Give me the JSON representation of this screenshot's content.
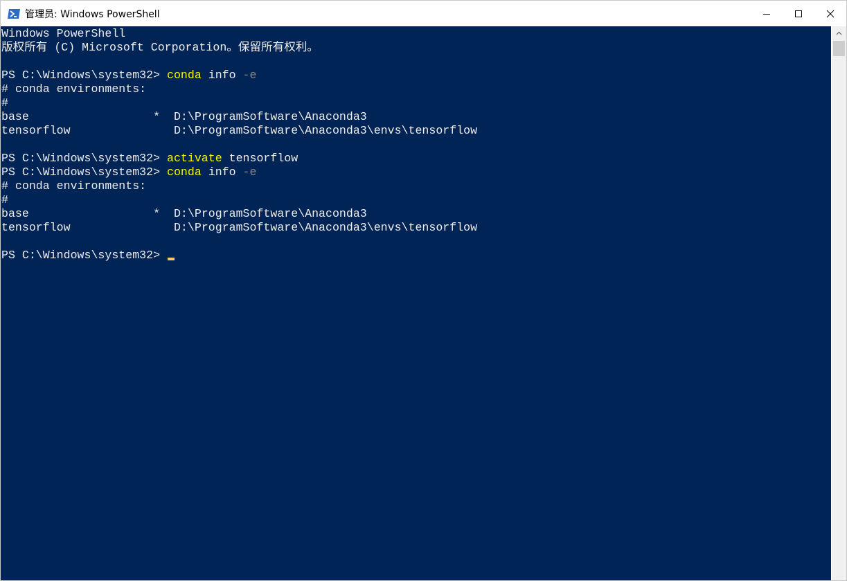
{
  "window": {
    "title": "管理员: Windows PowerShell",
    "app_icon": "powershell-icon",
    "controls": [
      "minimize-icon",
      "maximize-icon",
      "close-icon"
    ]
  },
  "console": {
    "lines": [
      {
        "text": "Windows PowerShell"
      },
      {
        "text": "版权所有 (C) Microsoft Corporation。保留所有权利。"
      },
      {
        "text": ""
      },
      {
        "prompt": "PS C:\\Windows\\system32> ",
        "command": "conda",
        "args": " info ",
        "param": "-e"
      },
      {
        "text": "# conda environments:"
      },
      {
        "text": "#"
      },
      {
        "text": "base                  *  D:\\ProgramSoftware\\Anaconda3"
      },
      {
        "text": "tensorflow               D:\\ProgramSoftware\\Anaconda3\\envs\\tensorflow"
      },
      {
        "text": ""
      },
      {
        "prompt": "PS C:\\Windows\\system32> ",
        "command": "activate",
        "args": " tensorflow",
        "param": ""
      },
      {
        "prompt": "PS C:\\Windows\\system32> ",
        "command": "conda",
        "args": " info ",
        "param": "-e"
      },
      {
        "text": "# conda environments:"
      },
      {
        "text": "#"
      },
      {
        "text": "base                  *  D:\\ProgramSoftware\\Anaconda3"
      },
      {
        "text": "tensorflow               D:\\ProgramSoftware\\Anaconda3\\envs\\tensorflow"
      },
      {
        "text": ""
      },
      {
        "prompt": "PS C:\\Windows\\system32> ",
        "command": "",
        "args": "",
        "param": "",
        "cursor": true
      }
    ]
  },
  "colors": {
    "console_bg": "#012456",
    "text": "#ececec",
    "command": "#f6f600",
    "parameter": "#8a8a8a",
    "cursor": "#f2c872"
  }
}
